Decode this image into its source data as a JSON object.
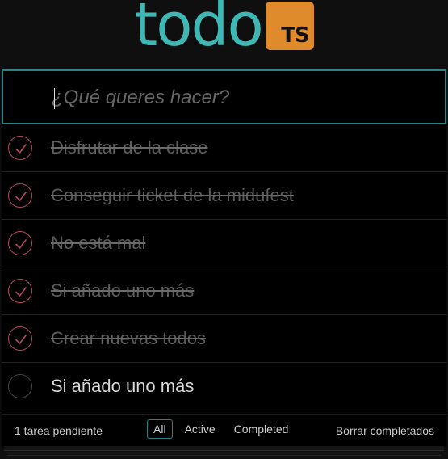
{
  "header": {
    "title": "todo",
    "badge": "TS"
  },
  "new_todo": {
    "placeholder": "¿Qué queres hacer?",
    "value": ""
  },
  "todos": [
    {
      "label": "Disfrutar de la clase",
      "completed": true
    },
    {
      "label": "Conseguir ticket de la midufest",
      "completed": true
    },
    {
      "label": "No está mal",
      "completed": true
    },
    {
      "label": "Si añado uno más",
      "completed": true
    },
    {
      "label": "Crear nuevas todos",
      "completed": true
    },
    {
      "label": "Si añado uno más",
      "completed": false
    }
  ],
  "footer": {
    "count_text": "1 tarea pendiente",
    "filters": [
      {
        "label": "All",
        "selected": true
      },
      {
        "label": "Active",
        "selected": false
      },
      {
        "label": "Completed",
        "selected": false
      }
    ],
    "clear_label": "Borrar completados"
  },
  "colors": {
    "accent": "#3fb7b5",
    "badge": "#e08b2b",
    "check": "#b24a5a"
  }
}
